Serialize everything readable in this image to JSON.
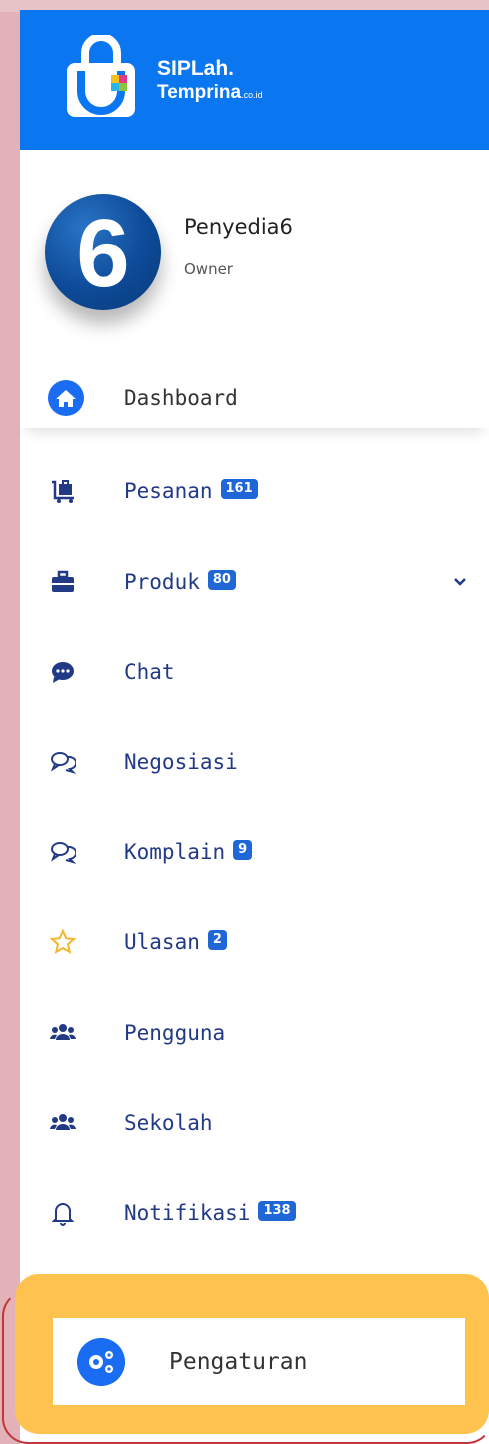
{
  "brand": {
    "line1": "SIPLah.",
    "line2": "Temprina",
    "suffix": ".co.id"
  },
  "profile": {
    "avatar_text": "6",
    "name": "Penyedia6",
    "role": "Owner"
  },
  "nav": [
    {
      "label": "Dashboard",
      "badge": "",
      "icon": "home-icon"
    },
    {
      "label": "Pesanan",
      "badge": "161",
      "icon": "shopping-cart-icon"
    },
    {
      "label": "Produk",
      "badge": "80",
      "icon": "briefcase-icon"
    },
    {
      "label": "Chat",
      "badge": "",
      "icon": "chat-bubble-icon"
    },
    {
      "label": "Negosiasi",
      "badge": "",
      "icon": "comments-icon"
    },
    {
      "label": "Komplain",
      "badge": "9",
      "icon": "comments-icon"
    },
    {
      "label": "Ulasan",
      "badge": "2",
      "icon": "star-icon"
    },
    {
      "label": "Pengguna",
      "badge": "",
      "icon": "users-icon"
    },
    {
      "label": "Sekolah",
      "badge": "",
      "icon": "users-icon"
    },
    {
      "label": "Notifikasi",
      "badge": "138",
      "icon": "bell-icon"
    }
  ],
  "settings": {
    "label": "Pengaturan",
    "icon": "gears-icon"
  },
  "colors": {
    "header": "#0a76f0",
    "nav_text": "#223a86",
    "badge": "#1f66d6",
    "highlight": "#fec24f",
    "star": "#f3b62b"
  }
}
